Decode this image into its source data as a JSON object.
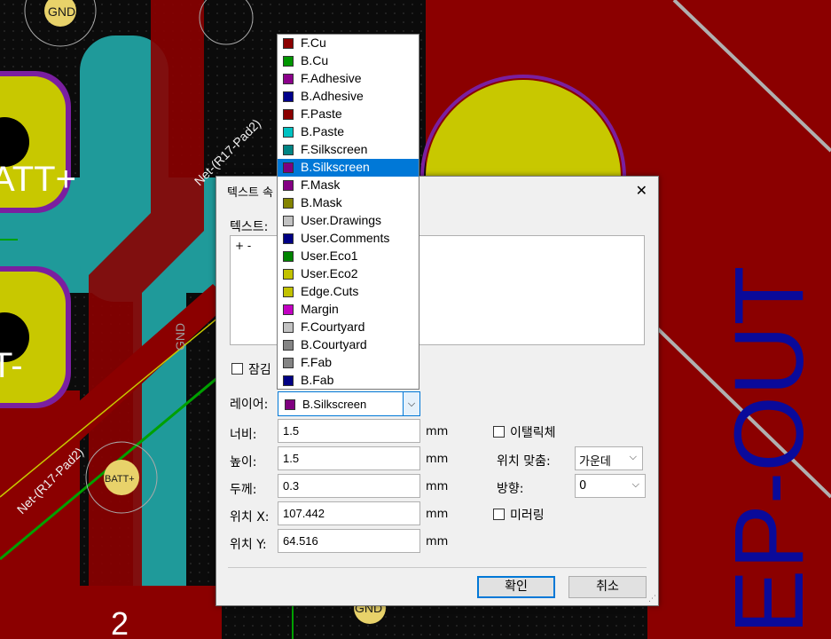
{
  "pcb": {
    "pad_labels": [
      "GND",
      "BATT+",
      "GND"
    ],
    "net_labels": [
      "Net-(R17-Pad2)",
      "Net-(R17-Pad2)"
    ],
    "silk_text": [
      "ATT+",
      "T-",
      "GND",
      "2"
    ],
    "right_text": "EP-OUT",
    "colors": {
      "background": "#0b0b0b",
      "copper_front": "#8b0000",
      "copper_back": "#1f9a9a",
      "pad": "#c8c800",
      "silk": "#9e9e9e",
      "outline": "#7a1fa0",
      "edge": "#00008b"
    }
  },
  "dialog": {
    "title": "텍스트 속",
    "close_icon": "close-icon",
    "text_label": "텍스트:",
    "text_value": "+ -",
    "lock_label": "잠김",
    "layer_label": "레이어:",
    "layer_value": "B.Silkscreen",
    "width_label": "너비:",
    "width_value": "1.5",
    "height_label": "높이:",
    "height_value": "1.5",
    "thickness_label": "두께:",
    "thickness_value": "0.3",
    "posx_label": "위치 X:",
    "posx_value": "107.442",
    "posy_label": "위치 Y:",
    "posy_value": "64.516",
    "unit": "mm",
    "italic_label": "이탤릭체",
    "justify_label": "위치 맞춤:",
    "justify_value": "가운데",
    "orientation_label": "방향:",
    "orientation_value": "0",
    "mirror_label": "미러링",
    "ok_label": "확인",
    "cancel_label": "취소"
  },
  "layer_list": [
    {
      "name": "F.Cu",
      "color": "#8b0000"
    },
    {
      "name": "B.Cu",
      "color": "#009600"
    },
    {
      "name": "F.Adhesive",
      "color": "#8b008b"
    },
    {
      "name": "B.Adhesive",
      "color": "#00008b"
    },
    {
      "name": "F.Paste",
      "color": "#8b0000"
    },
    {
      "name": "B.Paste",
      "color": "#00c2c2"
    },
    {
      "name": "F.Silkscreen",
      "color": "#008484"
    },
    {
      "name": "B.Silkscreen",
      "color": "#7f007f",
      "selected": true
    },
    {
      "name": "F.Mask",
      "color": "#840084"
    },
    {
      "name": "B.Mask",
      "color": "#848400"
    },
    {
      "name": "User.Drawings",
      "color": "#c2c2c2"
    },
    {
      "name": "User.Comments",
      "color": "#000084"
    },
    {
      "name": "User.Eco1",
      "color": "#008400"
    },
    {
      "name": "User.Eco2",
      "color": "#c2c200"
    },
    {
      "name": "Edge.Cuts",
      "color": "#c2c200"
    },
    {
      "name": "Margin",
      "color": "#c200c2"
    },
    {
      "name": "F.Courtyard",
      "color": "#c2c2c2"
    },
    {
      "name": "B.Courtyard",
      "color": "#848484"
    },
    {
      "name": "F.Fab",
      "color": "#848484"
    },
    {
      "name": "B.Fab",
      "color": "#000084"
    }
  ]
}
